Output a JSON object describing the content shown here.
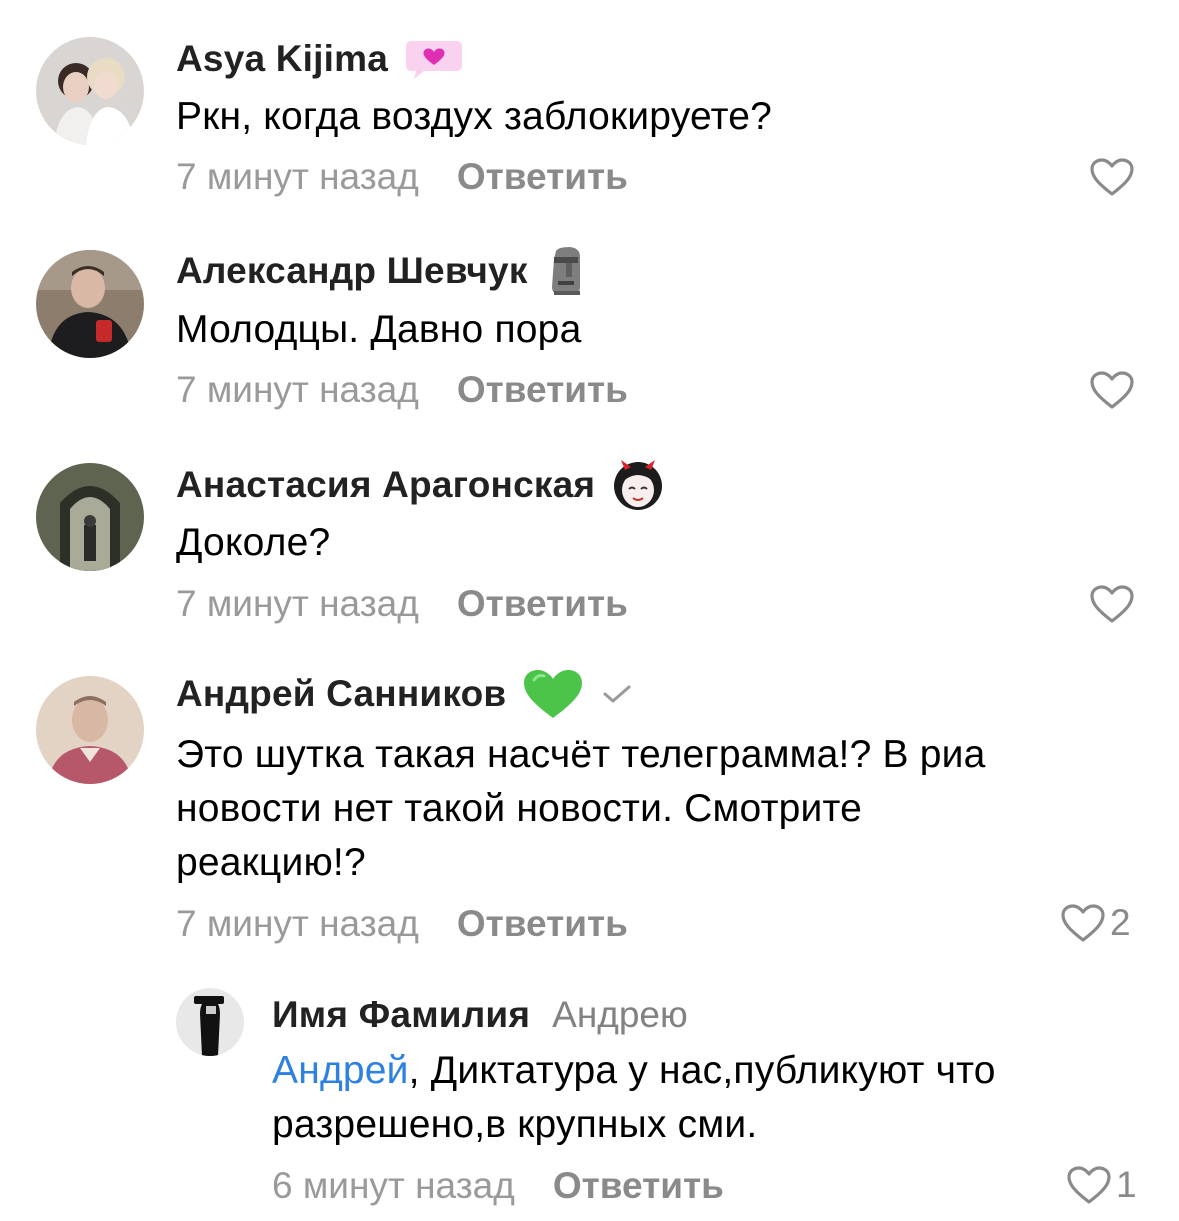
{
  "comments": [
    {
      "author": "Asya Kijima",
      "badge": "pink-heart-speech-bubble",
      "lines": [
        "Ркн, когда воздух заблокируете?"
      ],
      "time": "7 минут назад",
      "reply_label": "Ответить",
      "likes": ""
    },
    {
      "author": "Александр Шевчук",
      "badge": "moai-emoji",
      "lines": [
        "Молодцы. Давно пора"
      ],
      "time": "7 минут назад",
      "reply_label": "Ответить",
      "likes": ""
    },
    {
      "author": "Анастасия Арагонская",
      "badge": "anime-devil-girl-sticker",
      "lines": [
        "Доколе?"
      ],
      "time": "7 минут назад",
      "reply_label": "Ответить",
      "likes": ""
    },
    {
      "author": "Андрей Санников",
      "badge": "green-heart-emoji",
      "verified": "check-icon",
      "lines": [
        "Это шутка такая насчёт телеграмма!? В риа",
        "новости нет такой новости. Смотрите",
        "реакцию!?"
      ],
      "time": "7 минут назад",
      "reply_label": "Ответить",
      "likes": "2"
    }
  ],
  "reply": {
    "author": "Имя Фамилия",
    "addressee": "Андрею",
    "mention": "Андрей",
    "line1_rest": ", Диктатура у нас,публикуют что",
    "line2": "разрешено,в крупных сми.",
    "time": "6 минут назад",
    "reply_label": "Ответить",
    "likes": "1"
  },
  "colors": {
    "name": "#222222",
    "meta": "#9a9a9a",
    "mention": "#2d81e0",
    "heart_outline": "#8a8a8a"
  }
}
